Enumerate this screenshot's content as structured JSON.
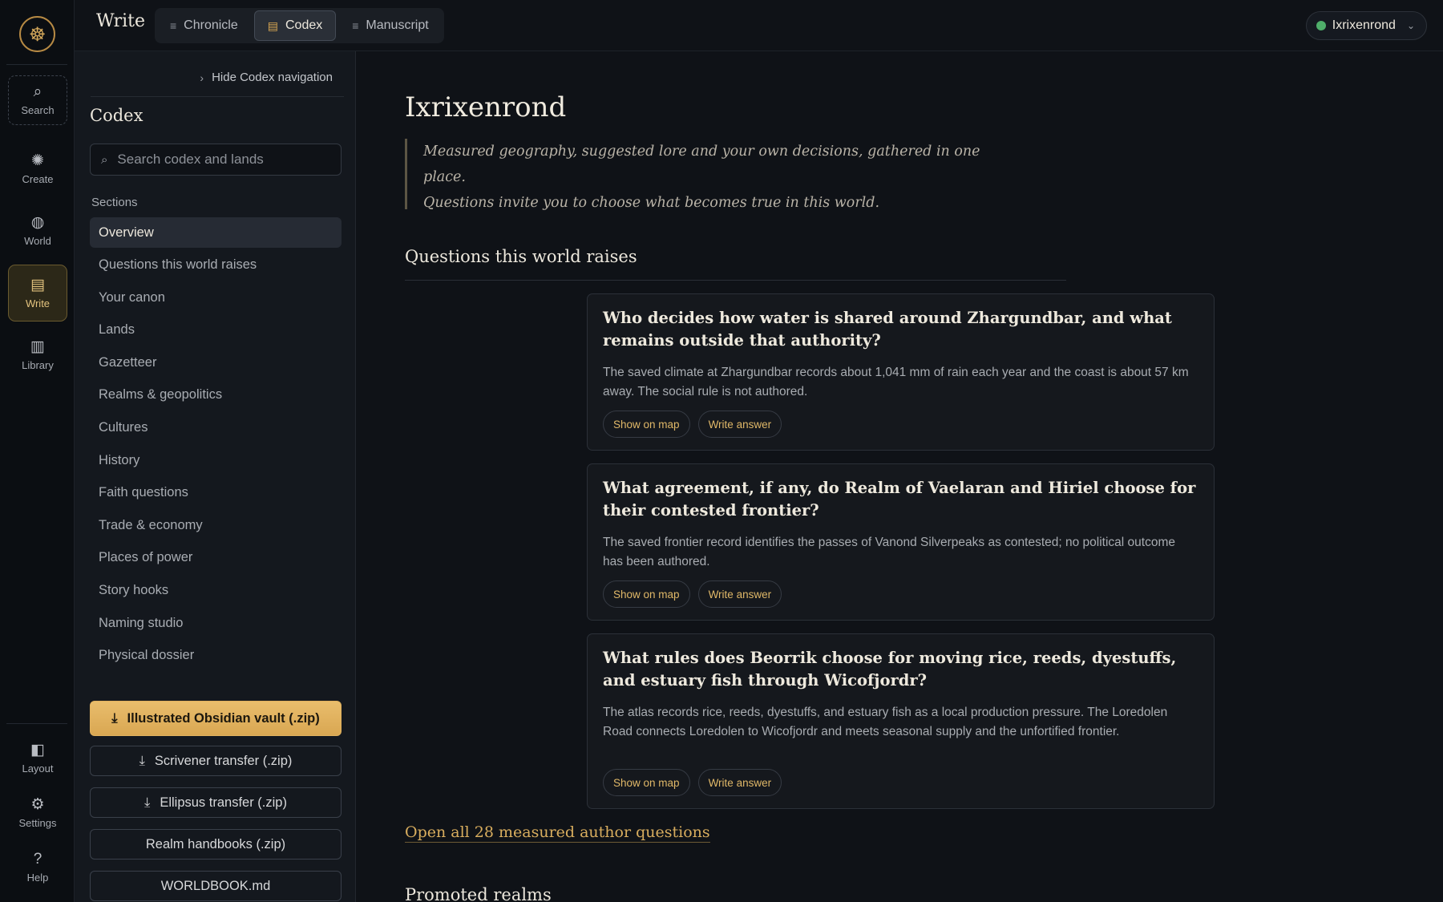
{
  "rail": {
    "logo_glyph": "☸",
    "top": [
      {
        "label": "Search",
        "icon": "search-icon",
        "glyph": "⌕"
      },
      {
        "label": "Create",
        "icon": "sparkle-icon",
        "glyph": "✺"
      },
      {
        "label": "World",
        "icon": "globe-icon",
        "glyph": "◍"
      },
      {
        "label": "Write",
        "icon": "book-icon",
        "glyph": "▤"
      },
      {
        "label": "Library",
        "icon": "library-icon",
        "glyph": "▥"
      }
    ],
    "bottom": [
      {
        "label": "Layout",
        "icon": "layout-icon",
        "glyph": "◧"
      },
      {
        "label": "Settings",
        "icon": "gear-icon",
        "glyph": "⚙"
      },
      {
        "label": "Help",
        "icon": "help-icon",
        "glyph": "?"
      }
    ]
  },
  "header": {
    "title": "Write",
    "tabs": [
      {
        "label": "Chronicle",
        "icon": "sliders-icon",
        "glyph": "≡"
      },
      {
        "label": "Codex",
        "icon": "book-icon",
        "glyph": "▤"
      },
      {
        "label": "Manuscript",
        "icon": "sliders-icon",
        "glyph": "≡"
      }
    ],
    "active_tab": "Codex",
    "user": {
      "name": "Ixrixenrond",
      "status_color": "#4fae6a"
    }
  },
  "codex": {
    "hide_label": "Hide Codex navigation",
    "title": "Codex",
    "search_placeholder": "Search codex and lands",
    "sections_label": "Sections",
    "items": [
      "Overview",
      "Questions this world raises",
      "Your canon",
      "Lands",
      "Gazetteer",
      "Realms & geopolitics",
      "Cultures",
      "History",
      "Faith questions",
      "Trade & economy",
      "Places of power",
      "Story hooks",
      "Naming studio",
      "Physical dossier"
    ],
    "active_item": "Overview",
    "exports": {
      "obsidian": "Illustrated Obsidian vault (.zip)",
      "scrivener": "Scrivener transfer (.zip)",
      "ellipsus": "Ellipsus transfer (.zip)",
      "handbooks": "Realm handbooks (.zip)",
      "worldbook": "WORLDBOOK.md"
    }
  },
  "main": {
    "title": "Ixrixenrond",
    "intro_line1": "Measured geography, suggested lore and your own decisions, gathered in one place.",
    "intro_line2": "Questions invite you to choose what becomes true in this world.",
    "questions_heading": "Questions this world raises",
    "questions": [
      {
        "title": "Who decides how water is shared around Zhargundbar, and what remains outside that authority?",
        "body": "The saved climate at Zhargundbar records about 1,041 mm of rain each year and the coast is about 57 km away. The social rule is not authored.",
        "map_label": "Show on map",
        "answer_label": "Write answer"
      },
      {
        "title": "What agreement, if any, do Realm of Vaelaran and Hiriel choose for their contested frontier?",
        "body": "The saved frontier record identifies the passes of Vanond Silverpeaks as contested; no political outcome has been authored.",
        "map_label": "Show on map",
        "answer_label": "Write answer"
      },
      {
        "title": "What rules does Beorrik choose for moving rice, reeds, dyestuffs, and estuary fish through Wicofjordr?",
        "body": "The atlas records rice, reeds, dyestuffs, and estuary fish as a local production pressure. The Loredolen Road connects Loredolen to Wicofjordr and meets seasonal supply and the unfortified frontier.",
        "map_label": "Show on map",
        "answer_label": "Write answer"
      }
    ],
    "open_all_link": "Open all 28 measured author questions",
    "promoted_heading": "Promoted realms"
  },
  "colors": {
    "accent": "#d9a752",
    "background": "#0f1217",
    "sidebar": "#14181e"
  }
}
